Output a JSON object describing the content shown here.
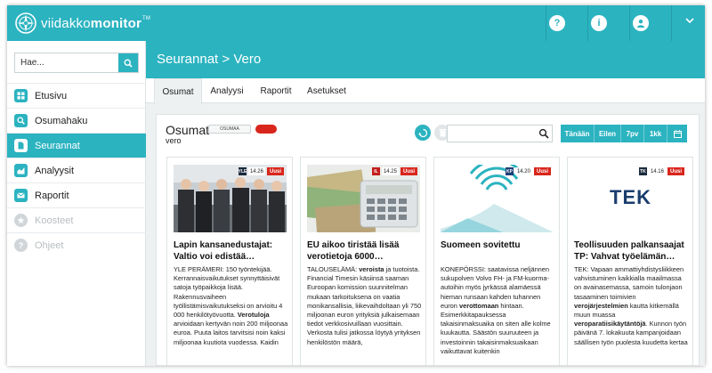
{
  "app": {
    "logo_light": "viidakko",
    "logo_bold": "monitor",
    "logo_tm": "TM"
  },
  "topbar": {
    "buttons": [
      {
        "name": "help",
        "glyph": "?"
      },
      {
        "name": "info",
        "glyph": "i"
      },
      {
        "name": "user",
        "glyph": "user-icon"
      }
    ],
    "menu_glyph": "chevron-down-icon"
  },
  "sidebar": {
    "search_placeholder": "Hae...",
    "items": [
      {
        "label": "Etusivu",
        "icon": "home-icon",
        "state": "normal"
      },
      {
        "label": "Osumahaku",
        "icon": "search-icon",
        "state": "normal"
      },
      {
        "label": "Seurannat",
        "icon": "document-icon",
        "state": "active"
      },
      {
        "label": "Analyysit",
        "icon": "chart-icon",
        "state": "normal"
      },
      {
        "label": "Raportit",
        "icon": "mail-icon",
        "state": "normal"
      },
      {
        "label": "Koosteet",
        "icon": "star-icon",
        "state": "disabled"
      },
      {
        "label": "Ohjeet",
        "icon": "question-icon",
        "state": "disabled"
      }
    ]
  },
  "main": {
    "title": "Seurannat > Vero",
    "tabs": [
      {
        "label": "Osumat",
        "active": true
      },
      {
        "label": "Analyysi",
        "active": false
      },
      {
        "label": "Raportit",
        "active": false
      },
      {
        "label": "Asetukset",
        "active": false
      }
    ]
  },
  "panel": {
    "title": "Osumat",
    "badge": "OSUMAA",
    "subtitle": "vero",
    "search_placeholder": "",
    "ranges": [
      "Tänään",
      "Eilen",
      "7pv",
      "1kk"
    ],
    "colors": {
      "accent": "#2bb3c0",
      "new": "#d9261c"
    }
  },
  "cards": [
    {
      "source_icon": "YLE",
      "time": "14.26",
      "badge": "Uusi",
      "title": "Lapin kansanedustajat: Valtio voi edistää…",
      "text": [
        {
          "t": "YLE PERÄMERI: 150 työntekijää. Kerrannaisvaikutukset synnyttäisivät satoja työpaikkoja lisää. Rakennusvaiheen työllistämisvaikutukseksi on arvioitu 4 000 henkilötyövuotta. "
        },
        {
          "t": "Verotuloja",
          "b": true
        },
        {
          "t": " arvioidaan kertyvän noin 200 miljoonaa euroa. Puuta laitos tarvitsisi noin kaksi miljoonaa kuutiota vuodessa. Kaidin"
        }
      ]
    },
    {
      "source_icon": "IL",
      "time": "14.25",
      "badge": "Uusi",
      "title": "EU aikoo tiristää lisää verotietoja 6000…",
      "text": [
        {
          "t": "TALOUSELÄMÄ: "
        },
        {
          "t": "veroista",
          "b": true
        },
        {
          "t": " ja tuotoista. Financial Timesin käsiinsä saaman Euroopan komission suunnitelman mukaan tarkoituksena on vaatia monikansallisia, liikevaihdoltaan yli 750 miljoonan euron yrityksiä julkaisemaan tiedot verkkosivuillaan vuosittain. Verkosta tulisi jatkossa löytyä yrityksen henkilöstön määrä,"
        }
      ]
    },
    {
      "source_icon": "KP",
      "time": "14.20",
      "badge": "Uusi",
      "title": "Suomeen sovitettu",
      "text": [
        {
          "t": "KONEPÖRSSI: saatavissa neljännen sukupolven Volvo FH- ja FM-kuorma-autoihin myös jyrkässä alamäessä hieman runsaan kahden tuhannen euron "
        },
        {
          "t": "verottomaan",
          "b": true
        },
        {
          "t": " hintaan. Esimerkkitapauksessa takaisinmaksuaika on siten alle kolme kuukautta. Säästön suuruuteen ja investoinnin takaisinmaksuaikaan vaikuttavat kuitenkin"
        }
      ]
    },
    {
      "source_icon": "TK",
      "time": "14.16",
      "badge": "Uusi",
      "title": "Teollisuuden palkansaajat TP: Vahvat työelämän…",
      "image_text": "TEK",
      "text": [
        {
          "t": "TEK: Vapaan ammattiyhdistysliikkeen vahvistuminen kaikkialla maailmassa on avainasemassa, samoin tulonjaon tasaaminen toimivien "
        },
        {
          "t": "verojärjestelmien",
          "b": true
        },
        {
          "t": " kautta kitkemällä muun muassa "
        },
        {
          "t": "veroparatiisikäytäntöjä",
          "b": true
        },
        {
          "t": ". Kunnon työn päivänä 7. lokakuuta kampanjoidaan säällisen työn puolesta kuudetta kertaa"
        }
      ]
    }
  ]
}
